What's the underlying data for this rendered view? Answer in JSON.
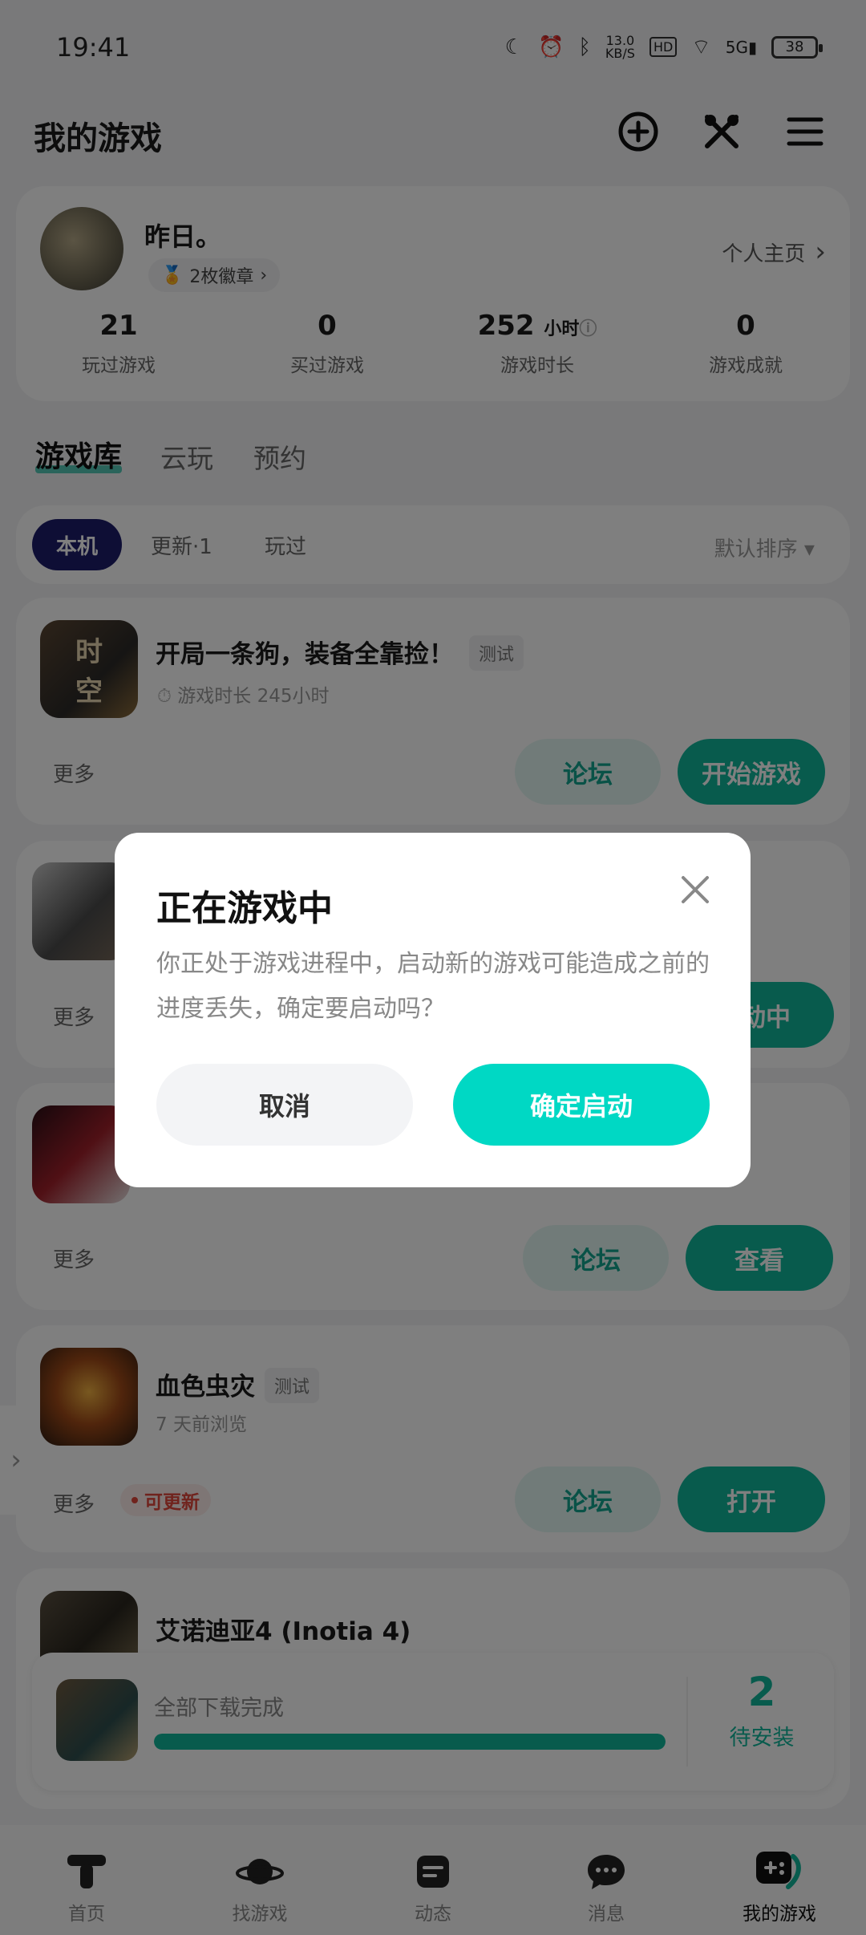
{
  "status_bar": {
    "time": "19:41",
    "net_speed": "13.0",
    "net_unit": "KB/S",
    "hd": "HD",
    "signal": "5G",
    "battery": "38"
  },
  "header": {
    "title": "我的游戏"
  },
  "profile": {
    "name": "昨日。",
    "badges": "2枚徽章",
    "homepage_link": "个人主页",
    "stats": [
      {
        "value": "21",
        "unit": "",
        "label": "玩过游戏"
      },
      {
        "value": "0",
        "unit": "",
        "label": "买过游戏"
      },
      {
        "value": "252",
        "unit": "小时",
        "label": "游戏时长"
      },
      {
        "value": "0",
        "unit": "",
        "label": "游戏成就"
      }
    ]
  },
  "library_tabs": [
    "游戏库",
    "云玩",
    "预约"
  ],
  "filters": {
    "chips": [
      "本机",
      "更新·1",
      "玩过"
    ],
    "sort": "默认排序"
  },
  "games": [
    {
      "title": "开局一条狗，装备全靠捡！",
      "tag": "测试",
      "subtitle": "游戏时长 245小时",
      "more": "更多",
      "forum": "论坛",
      "action": "开始游戏",
      "icon_text_1": "时",
      "icon_text_2": "空"
    },
    {
      "more": "更多",
      "action": "动中"
    },
    {
      "more": "更多",
      "forum": "论坛",
      "action": "查看"
    },
    {
      "title": "血色虫灾",
      "tag": "测试",
      "subtitle": "7 天前浏览",
      "more": "更多",
      "badge": "可更新",
      "forum": "论坛",
      "action": "打开"
    },
    {
      "title": "艾诺迪亚4 (Inotia 4)"
    }
  ],
  "download_bar": {
    "status": "全部下载完成",
    "progress": 1.0,
    "count": "2",
    "count_label": "待安装"
  },
  "bottom_nav": [
    "首页",
    "找游戏",
    "动态",
    "消息",
    "我的游戏"
  ],
  "dialog": {
    "title": "正在游戏中",
    "body": "你正处于游戏进程中，启动新的游戏可能造成之前的进度丢失，确定要启动吗？",
    "cancel": "取消",
    "confirm": "确定启动"
  },
  "colors": {
    "accent": "#11b69b",
    "confirm": "#00d8c4",
    "dark_chip": "#1d1d6b",
    "update_badge": "#e0463a"
  }
}
